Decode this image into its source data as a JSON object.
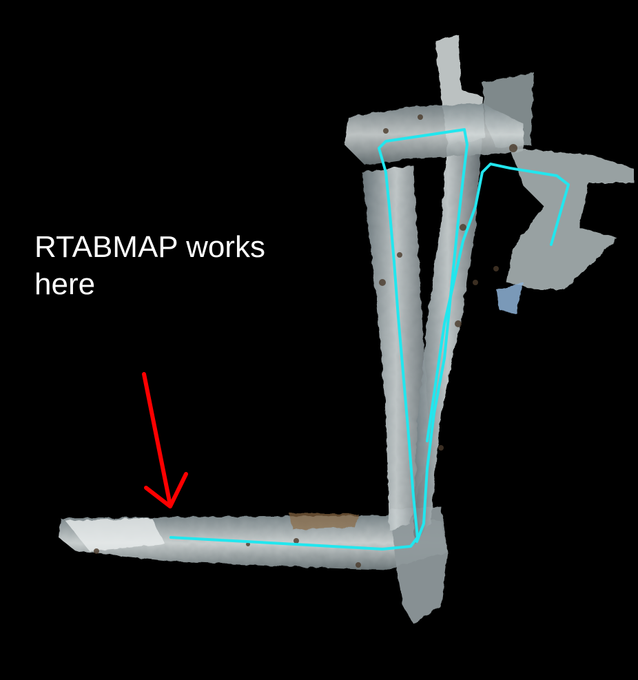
{
  "annotation": {
    "line1": "RTABMAP works",
    "line2": "here"
  },
  "icons": {
    "arrow": "arrow-down-right-icon",
    "map": "point-cloud-map",
    "trajectory": "trajectory-path"
  },
  "colors": {
    "background": "#000000",
    "annotation_text": "#ffffff",
    "arrow": "#ff0000",
    "trajectory": "#22e6ee",
    "map_base": "#9aa5a8"
  }
}
